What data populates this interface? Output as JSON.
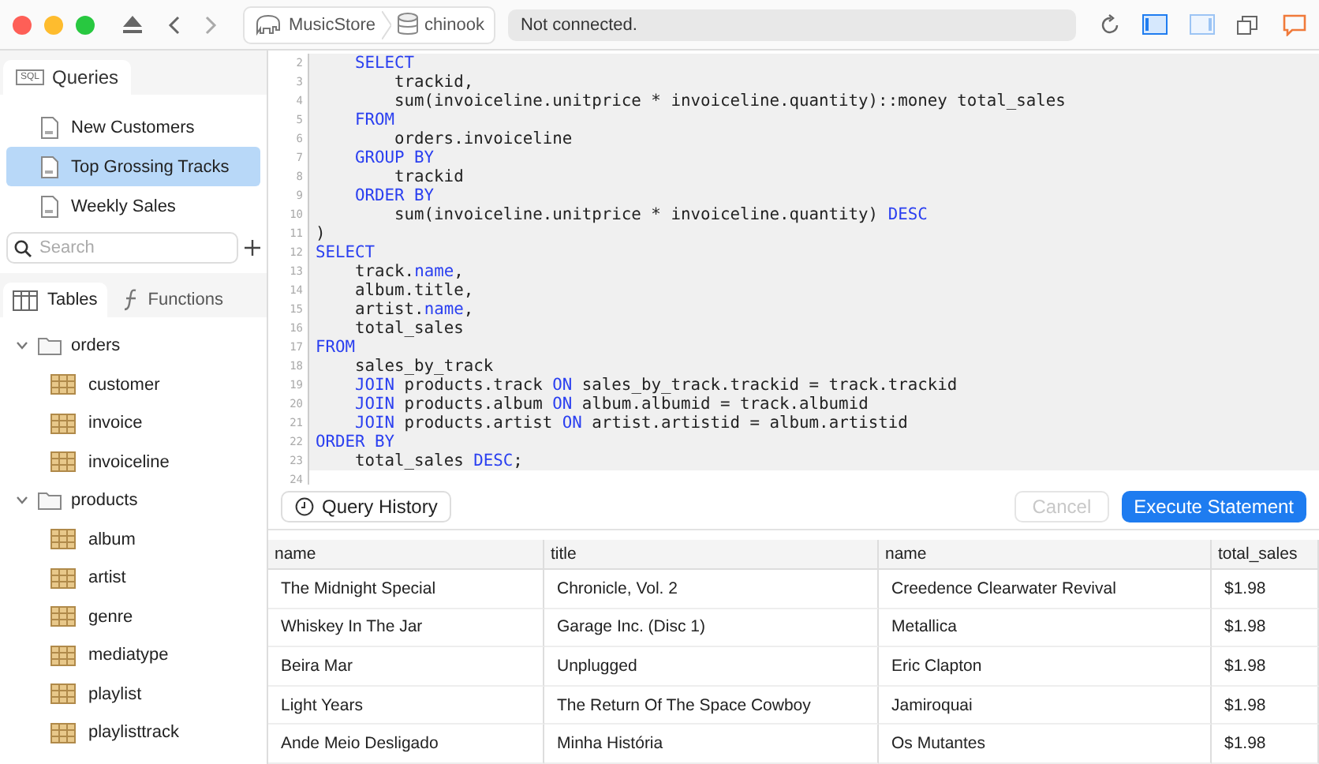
{
  "toolbar": {
    "breadcrumb": [
      "MusicStore",
      "chinook"
    ],
    "status": "Not connected.",
    "left_panel_on": true,
    "right_panel_on": false
  },
  "sidebar": {
    "query_tab": {
      "icon_text": "SQL",
      "label": "Queries",
      "selected": true
    },
    "queries": [
      {
        "label": "New Customers",
        "selected": false
      },
      {
        "label": "Top Grossing Tracks",
        "selected": true
      },
      {
        "label": "Weekly Sales",
        "selected": false
      }
    ],
    "search": {
      "placeholder": "Search"
    },
    "tabs": [
      {
        "label": "Tables",
        "selected": true
      },
      {
        "label": "Functions",
        "selected": false
      }
    ],
    "tree": [
      {
        "label": "orders",
        "expanded": true,
        "children": [
          {
            "label": "customer"
          },
          {
            "label": "invoice"
          },
          {
            "label": "invoiceline"
          }
        ]
      },
      {
        "label": "products",
        "expanded": true,
        "children": [
          {
            "label": "album"
          },
          {
            "label": "artist"
          },
          {
            "label": "genre"
          },
          {
            "label": "mediatype"
          },
          {
            "label": "playlist"
          },
          {
            "label": "playlisttrack"
          }
        ]
      }
    ]
  },
  "editor": {
    "lines": [
      {
        "num": "2",
        "selected": true,
        "kind": "inner",
        "tokens": [
          {
            "text": "SELECT",
            "kind": "keyword"
          }
        ]
      },
      {
        "num": "3",
        "selected": true,
        "kind": "inner2",
        "tokens": [
          {
            "text": "trackid,"
          }
        ]
      },
      {
        "num": "4",
        "selected": true,
        "kind": "inner2",
        "tokens": [
          {
            "text": "sum(invoiceline.unitprice * invoiceline.quantity)::money total_sales"
          }
        ]
      },
      {
        "num": "5",
        "selected": true,
        "kind": "inner",
        "tokens": [
          {
            "text": "FROM",
            "kind": "keyword"
          }
        ]
      },
      {
        "num": "6",
        "selected": true,
        "kind": "inner2",
        "tokens": [
          {
            "text": "orders.invoiceline"
          }
        ]
      },
      {
        "num": "7",
        "selected": true,
        "kind": "inner",
        "tokens": [
          {
            "text": "GROUP BY",
            "kind": "keyword"
          }
        ]
      },
      {
        "num": "8",
        "selected": true,
        "kind": "inner2",
        "tokens": [
          {
            "text": "trackid"
          }
        ]
      },
      {
        "num": "9",
        "selected": true,
        "kind": "inner",
        "tokens": [
          {
            "text": "ORDER BY",
            "kind": "keyword"
          }
        ]
      },
      {
        "num": "10",
        "selected": true,
        "kind": "inner2",
        "tokens": [
          {
            "text": "sum(invoiceline.unitprice * invoiceline.quantity) "
          },
          {
            "text": "DESC",
            "kind": "keyword"
          }
        ]
      },
      {
        "num": "11",
        "selected": true,
        "kind": "top",
        "tokens": [
          {
            "text": ")"
          }
        ]
      },
      {
        "num": "12",
        "selected": true,
        "kind": "top",
        "tokens": [
          {
            "text": "SELECT",
            "kind": "keyword"
          }
        ]
      },
      {
        "num": "13",
        "selected": true,
        "kind": "inner",
        "tokens": [
          {
            "text": "track."
          },
          {
            "text": "name",
            "kind": "keyword"
          },
          {
            "text": ","
          }
        ]
      },
      {
        "num": "14",
        "selected": true,
        "kind": "inner",
        "tokens": [
          {
            "text": "album.title,"
          }
        ]
      },
      {
        "num": "15",
        "selected": true,
        "kind": "inner",
        "tokens": [
          {
            "text": "artist."
          },
          {
            "text": "name",
            "kind": "keyword"
          },
          {
            "text": ","
          }
        ]
      },
      {
        "num": "16",
        "selected": true,
        "kind": "inner",
        "tokens": [
          {
            "text": "total_sales"
          }
        ]
      },
      {
        "num": "17",
        "selected": true,
        "kind": "top",
        "tokens": [
          {
            "text": "FROM",
            "kind": "keyword"
          }
        ]
      },
      {
        "num": "18",
        "selected": true,
        "kind": "inner",
        "tokens": [
          {
            "text": "sales_by_track"
          }
        ]
      },
      {
        "num": "19",
        "selected": true,
        "kind": "inner",
        "tokens": [
          {
            "text": "JOIN",
            "kind": "keyword"
          },
          {
            "text": " products.track "
          },
          {
            "text": "ON",
            "kind": "keyword"
          },
          {
            "text": " sales_by_track.trackid = track.trackid"
          }
        ]
      },
      {
        "num": "20",
        "selected": true,
        "kind": "inner",
        "tokens": [
          {
            "text": "JOIN",
            "kind": "keyword"
          },
          {
            "text": " products.album "
          },
          {
            "text": "ON",
            "kind": "keyword"
          },
          {
            "text": " album.albumid = track.albumid"
          }
        ]
      },
      {
        "num": "21",
        "selected": true,
        "kind": "inner",
        "tokens": [
          {
            "text": "JOIN",
            "kind": "keyword"
          },
          {
            "text": " products.artist "
          },
          {
            "text": "ON",
            "kind": "keyword"
          },
          {
            "text": " artist.artistid = album.artistid"
          }
        ]
      },
      {
        "num": "22",
        "selected": true,
        "kind": "top",
        "tokens": [
          {
            "text": "ORDER BY",
            "kind": "keyword"
          }
        ]
      },
      {
        "num": "23",
        "selected": true,
        "kind": "inner",
        "tokens": [
          {
            "text": "total_sales "
          },
          {
            "text": "DESC",
            "kind": "keyword"
          },
          {
            "text": ";"
          }
        ]
      },
      {
        "num": "24"
      }
    ]
  },
  "actions": {
    "history": "Query History",
    "cancel": {
      "label": "Cancel",
      "disabled": true
    },
    "execute": "Execute Statement"
  },
  "results": {
    "columns": [
      "name",
      "title",
      "name",
      "total_sales"
    ],
    "rows": [
      [
        "The Midnight Special",
        "Chronicle, Vol. 2",
        "Creedence Clearwater Revival",
        "$1.98"
      ],
      [
        "Whiskey In The Jar",
        "Garage Inc. (Disc 1)",
        "Metallica",
        "$1.98"
      ],
      [
        "Beira Mar",
        "Unplugged",
        "Eric Clapton",
        "$1.98"
      ],
      [
        "Light Years",
        "The Return Of The Space Cowboy",
        "Jamiroquai",
        "$1.98"
      ],
      [
        "Ande Meio Desligado",
        "Minha História",
        "Os Mutantes",
        "$1.98"
      ]
    ]
  }
}
